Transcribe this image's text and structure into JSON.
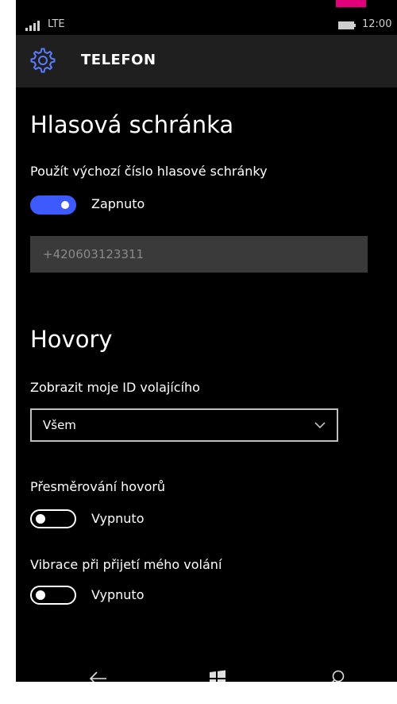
{
  "status_bar": {
    "network": "LTE",
    "time": "12:00"
  },
  "header": {
    "title": "TELEFON",
    "icon": "gear-icon"
  },
  "voicemail": {
    "heading": "Hlasová schránka",
    "default_number_label": "Použít výchozí číslo hlasové schránky",
    "toggle_state": "Zapnuto",
    "toggle_on": true,
    "number_placeholder": "+420603123311"
  },
  "calls": {
    "heading": "Hovory",
    "caller_id_label": "Zobrazit moje ID volajícího",
    "caller_id_value": "Všem",
    "forwarding_label": "Přesměrování hovorů",
    "forwarding_state": "Vypnuto",
    "forwarding_on": false,
    "vibrate_label": "Vibrace při přijetí mého volání",
    "vibrate_state": "Vypnuto",
    "vibrate_on": false
  },
  "nav": {
    "back_icon": "back-arrow-icon",
    "home_icon": "windows-icon",
    "search_icon": "search-icon"
  },
  "colors": {
    "accent": "#3d5afe",
    "header_bg": "#1f1f1f",
    "background": "#000000",
    "input_bg": "#3a3a3a",
    "corner_accent": "#e2007a"
  }
}
